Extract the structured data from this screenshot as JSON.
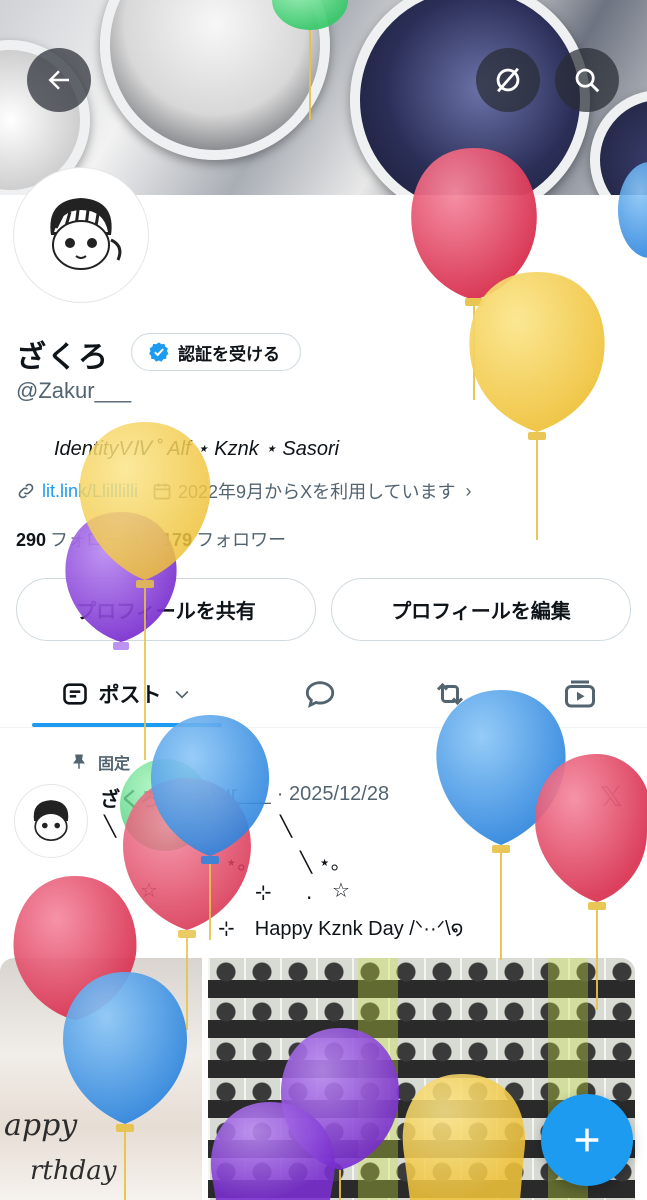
{
  "header": {
    "back_icon": "arrow-left-icon",
    "ghost_icon": "circle-slash-icon",
    "search_icon": "search-icon"
  },
  "profile": {
    "display_name": "ざくろ",
    "verify_label": "認証を受ける",
    "handle": "@Zakur___",
    "bio": "IdentityVⅣ ˚ Alf ⋆ Kznk ⋆ Sasori",
    "link": "lit.link/Llilllilli",
    "joined": "2022年9月からXを利用しています",
    "following_count": "290",
    "following_label": "フォロー中",
    "followers_count": "179",
    "followers_label": "フォロワー",
    "share_label": "プロフィールを共有",
    "edit_label": "プロフィールを編集"
  },
  "tabs": {
    "posts_label": "ポスト"
  },
  "post": {
    "pinned_label": "固定",
    "name": "ざくろ",
    "handle": "@Zakur___",
    "date": "· 2025/12/28",
    "text": "⊹　Happy Kznk Day /ᐠ··ᐟ\\໑",
    "media1_script": "appy",
    "media1_script2": "rthday"
  },
  "colors": {
    "accent": "#1d9bf0",
    "balloon_red": "#e0435f",
    "balloon_yellow": "#f2c94c",
    "balloon_blue": "#3f9be8",
    "balloon_purple": "#8a3fd6",
    "balloon_green": "#4cd97b"
  }
}
